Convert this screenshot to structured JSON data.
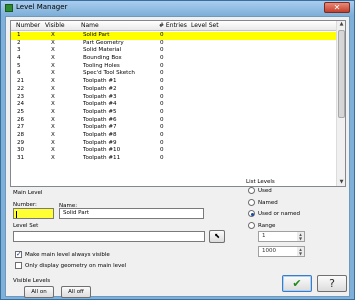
{
  "window": {
    "title": "Level Manager",
    "close_glyph": "✕"
  },
  "grid": {
    "columns": [
      "Number",
      "Visible",
      "Name",
      "# Entries",
      "Level Set"
    ],
    "rows": [
      {
        "number": "1",
        "visible": "X",
        "name": "Solid Part",
        "entries": "0",
        "selected": true
      },
      {
        "number": "2",
        "visible": "X",
        "name": "Part Geometry",
        "entries": "0"
      },
      {
        "number": "3",
        "visible": "X",
        "name": "Solid Material",
        "entries": "0"
      },
      {
        "number": "4",
        "visible": "X",
        "name": "Bounding Box",
        "entries": "0"
      },
      {
        "number": "5",
        "visible": "X",
        "name": "Tooling Holes",
        "entries": "0"
      },
      {
        "number": "6",
        "visible": "X",
        "name": "Spec'd Tool Sketch",
        "entries": "0"
      },
      {
        "number": "21",
        "visible": "X",
        "name": "Toolpath #1",
        "entries": "0"
      },
      {
        "number": "22",
        "visible": "X",
        "name": "Toolpath #2",
        "entries": "0"
      },
      {
        "number": "23",
        "visible": "X",
        "name": "Toolpath #3",
        "entries": "0"
      },
      {
        "number": "24",
        "visible": "X",
        "name": "Toolpath #4",
        "entries": "0"
      },
      {
        "number": "25",
        "visible": "X",
        "name": "Toolpath #5",
        "entries": "0"
      },
      {
        "number": "26",
        "visible": "X",
        "name": "Toolpath #6",
        "entries": "0"
      },
      {
        "number": "27",
        "visible": "X",
        "name": "Toolpath #7",
        "entries": "0"
      },
      {
        "number": "28",
        "visible": "X",
        "name": "Toolpath #8",
        "entries": "0"
      },
      {
        "number": "29",
        "visible": "X",
        "name": "Toolpath #9",
        "entries": "0"
      },
      {
        "number": "30",
        "visible": "X",
        "name": "Toolpath #10",
        "entries": "0"
      },
      {
        "number": "31",
        "visible": "X",
        "name": "Toolpath #11",
        "entries": "0"
      }
    ]
  },
  "main_level": {
    "heading": "Main Level",
    "number_label": "Number:",
    "number_value": "",
    "name_label": "Name:",
    "name_value": "Solid Part",
    "level_set_label": "Level Set",
    "level_set_value": ""
  },
  "options": {
    "make_visible": "Make main level always visible",
    "make_visible_checked": true,
    "only_display": "Only display geometry on main level",
    "only_display_checked": false
  },
  "visible_levels": {
    "heading": "Visible Levels",
    "all_on": "All on",
    "all_off": "All off"
  },
  "list_levels": {
    "heading": "List Levels",
    "options": [
      "Used",
      "Named",
      "Used or named",
      "Range"
    ],
    "selected": "Used or named",
    "range_from": "1",
    "range_to": "1000"
  },
  "buttons": {
    "ok_glyph": "✔",
    "help_glyph": "?"
  },
  "colors": {
    "selected_row": "#ffff00",
    "number_field": "#ffff33",
    "ok_check": "#1d8a1d"
  }
}
